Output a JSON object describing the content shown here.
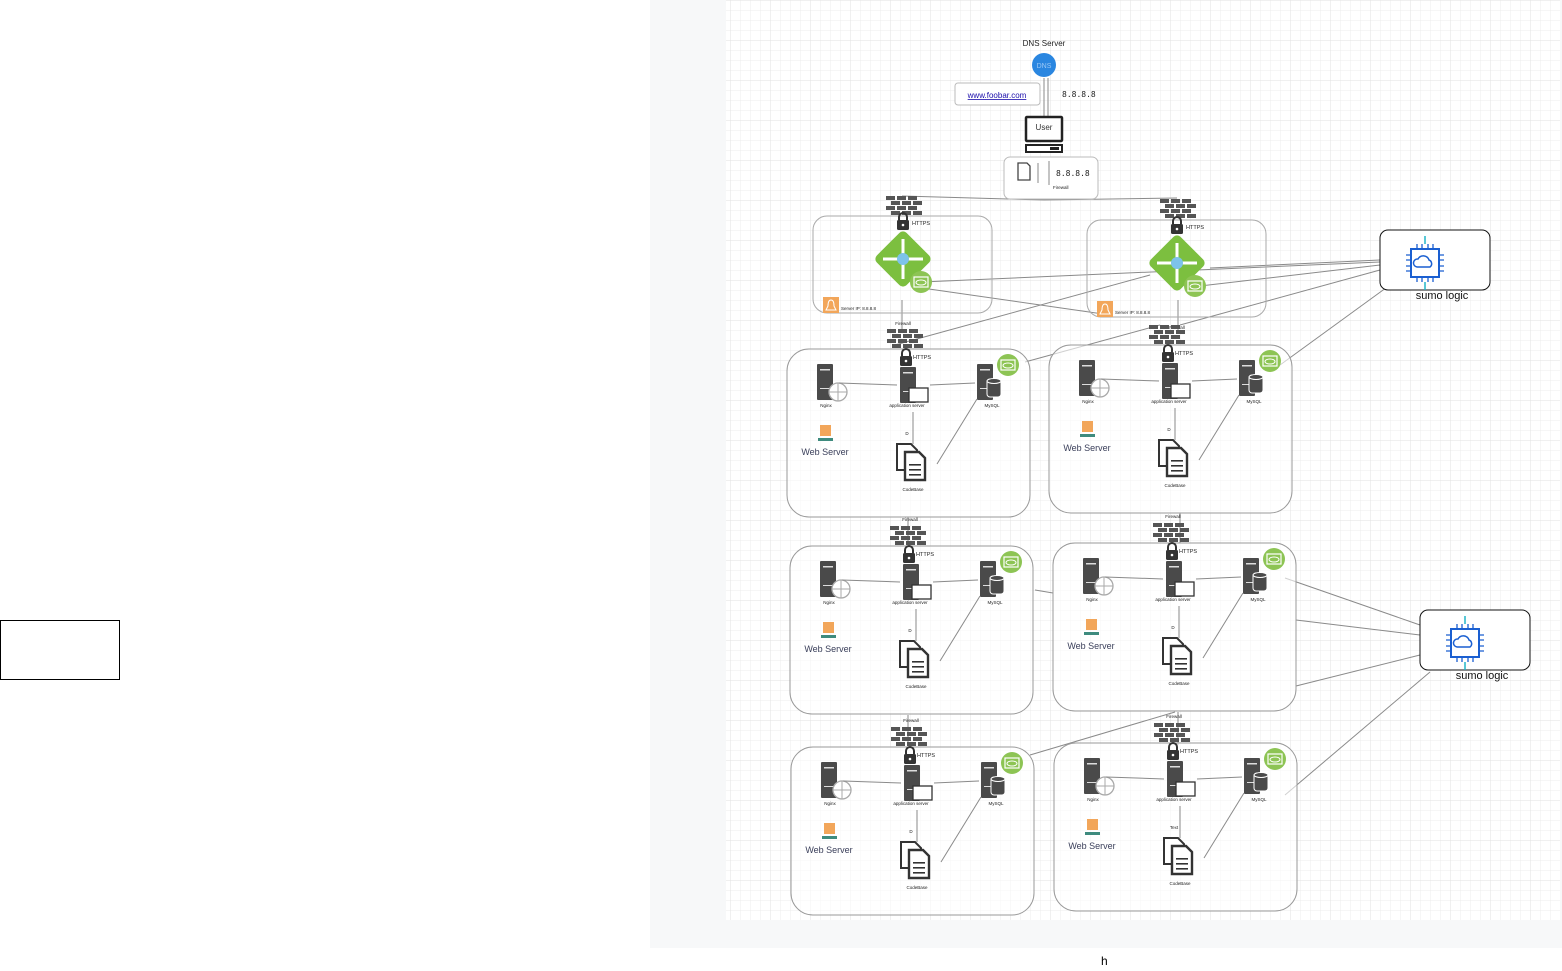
{
  "dns": {
    "title": "DNS Server",
    "icon_text": "DNS",
    "ip": "8.8.8.8"
  },
  "url_link": "www.foobar.com",
  "user": {
    "label": "User"
  },
  "user_firewall": {
    "ip": "8.8.8.8",
    "label": "Firewall"
  },
  "load_balancers": [
    {
      "https": "HTTPS",
      "server_ip_label": "Server IP: 8.8.8.8",
      "firewall_below": "Firewall"
    },
    {
      "https": "HTTPS",
      "server_ip_label": "Server IP: 8.8.8.8",
      "firewall_below": "Firewall"
    }
  ],
  "servers": [
    {
      "https": "HTTPS",
      "nginx": "Nginx",
      "app": "application server",
      "db": "MySQL",
      "web": "Web Server",
      "edge": "D",
      "code": "CodeBase",
      "firewall": ""
    },
    {
      "https": "HTTPS",
      "nginx": "Nginx",
      "app": "application server",
      "db": "MySQL",
      "web": "Web Server",
      "edge": "D",
      "code": "CodeBase",
      "firewall": ""
    },
    {
      "https": "HTTPS",
      "nginx": "Nginx",
      "app": "application server",
      "db": "MySQL",
      "web": "Web Server",
      "edge": "D",
      "code": "CodeBase",
      "firewall": "Firewall"
    },
    {
      "https": "HTTPS",
      "nginx": "Nginx",
      "app": "application server",
      "db": "MySQL",
      "web": "Web Server",
      "edge": "D",
      "code": "CodeBase",
      "firewall": "Firewall"
    },
    {
      "https": "HTTPS",
      "nginx": "Nginx",
      "app": "application server",
      "db": "MySQL",
      "web": "Web Server",
      "edge": "D",
      "code": "CodeBase",
      "firewall": "Firewall"
    },
    {
      "https": "HTTPS",
      "nginx": "Nginx",
      "app": "application server",
      "db": "MySQL",
      "web": "Web Server",
      "edge": "Text",
      "code": "CodeBase",
      "firewall": "Firewall"
    }
  ],
  "monitors": [
    {
      "label": "sumo logic"
    },
    {
      "label": "sumo logic"
    }
  ],
  "footer_text": "h",
  "colors": {
    "lb_green": "#7cbf3f",
    "eye_green": "#8dc454",
    "dns_blue": "#2a86e0",
    "linux_orange": "#f2a65a",
    "icon_dark": "#4a4a4a",
    "chip_blue": "#1a5fd1",
    "chip_cyan": "#22b6c8"
  }
}
